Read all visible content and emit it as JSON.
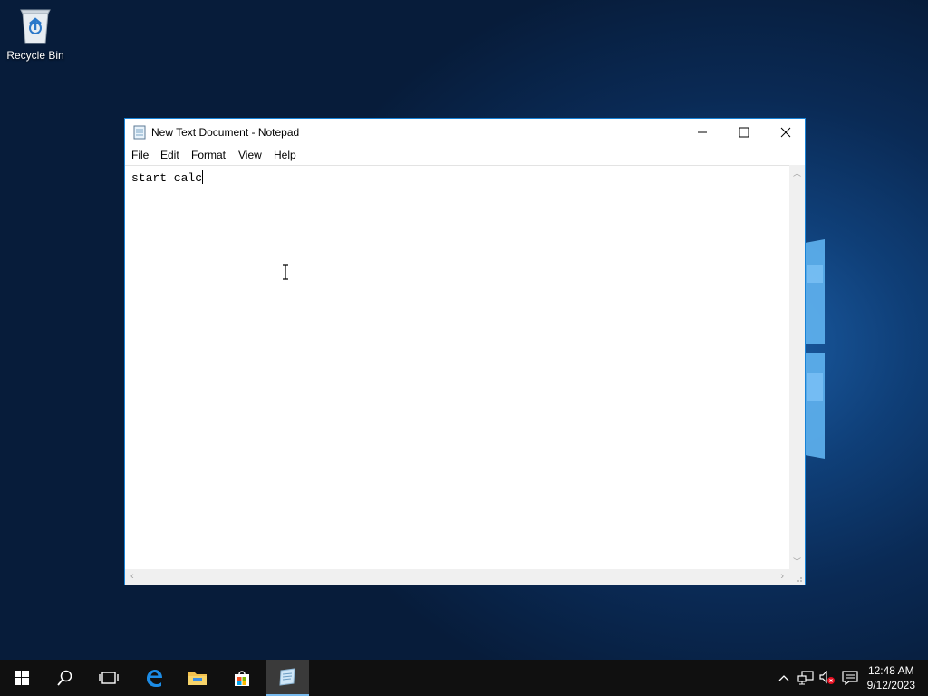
{
  "desktop": {
    "recycle_bin_label": "Recycle Bin"
  },
  "window": {
    "title": "New Text Document - Notepad",
    "menu": [
      "File",
      "Edit",
      "Format",
      "View",
      "Help"
    ],
    "content": "start calc"
  },
  "taskbar": {
    "icons": [
      "start-icon",
      "search-icon",
      "task-view-icon",
      "edge-icon",
      "file-explorer-icon",
      "store-icon",
      "notepad-icon"
    ],
    "clock_time": "12:48 AM",
    "clock_date": "9/12/2023"
  },
  "colors": {
    "accent": "#1883d7",
    "taskbar": "#101010",
    "active_indicator": "#76b9ed"
  }
}
